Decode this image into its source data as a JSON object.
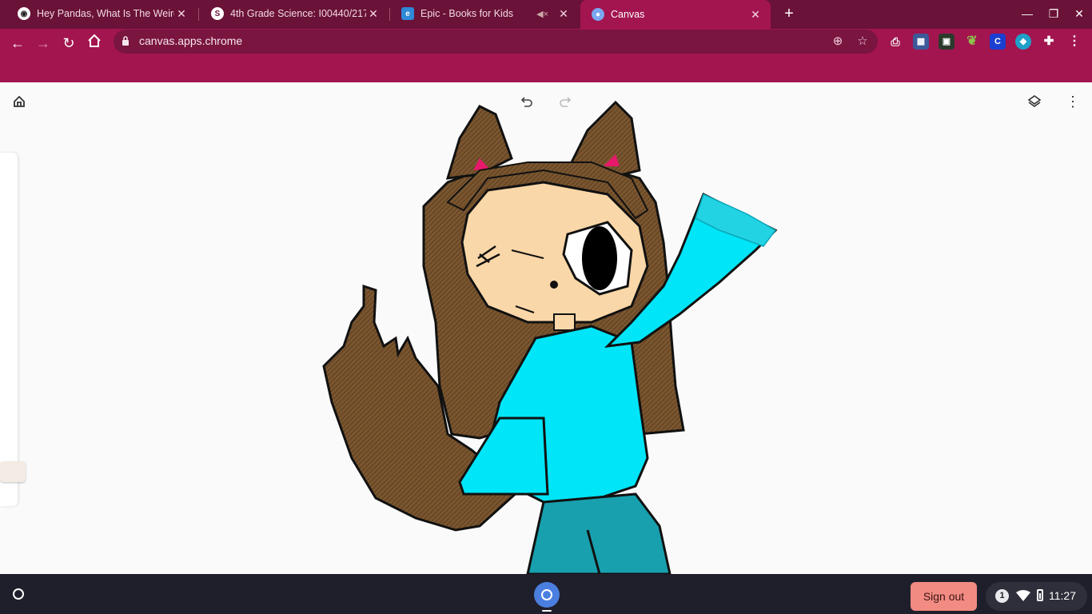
{
  "browser": {
    "tabs": [
      {
        "title": "Hey Pandas, What Is The Weirde",
        "favicon": "bored-panda-icon",
        "active": false
      },
      {
        "title": "4th Grade Science: I00440/217 -",
        "favicon": "schoology-icon",
        "active": false
      },
      {
        "title": "Epic - Books for Kids",
        "favicon": "epic-icon",
        "active": false,
        "muted": true
      },
      {
        "title": "Canvas",
        "favicon": "canvas-icon",
        "active": true
      }
    ],
    "url": "canvas.apps.chrome",
    "extensions": [
      "print-icon",
      "calculator-icon",
      "app-icon",
      "leaf-icon",
      "c-extension-icon",
      "shield-extension-icon",
      "puzzle-icon"
    ],
    "colors": {
      "tabstrip": "#6a1238",
      "toolbar": "#a3154f"
    }
  },
  "canvas_app": {
    "toolbar_icons": [
      "home-icon",
      "undo-icon",
      "redo-icon",
      "layers-icon",
      "more-vert-icon"
    ]
  },
  "shelf": {
    "signout_label": "Sign out",
    "notification_count": "1",
    "time": "11:27"
  }
}
